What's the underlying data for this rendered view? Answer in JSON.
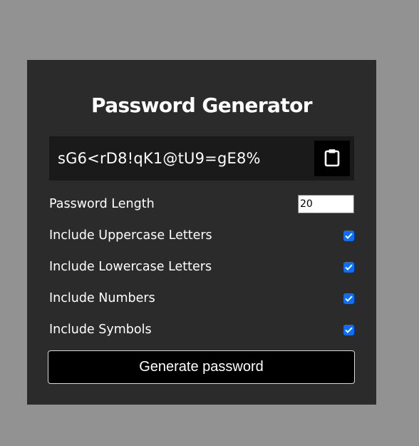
{
  "app": {
    "title": "Password Generator"
  },
  "result": {
    "password": "sG6<rD8!qK1@tU9=gE8%",
    "copy_icon": "clipboard-icon"
  },
  "settings": {
    "length_label": "Password Length",
    "length_value": "20",
    "options": [
      {
        "label": "Include Uppercase Letters",
        "checked": true
      },
      {
        "label": "Include Lowercase Letters",
        "checked": true
      },
      {
        "label": "Include Numbers",
        "checked": true
      },
      {
        "label": "Include Symbols",
        "checked": true
      }
    ]
  },
  "generate_button": {
    "label": "Generate password"
  },
  "colors": {
    "page_background": "#929292",
    "card_background": "#2b2b2b",
    "result_background": "#1a1a1a",
    "checkbox_accent": "#0b6ffd"
  }
}
